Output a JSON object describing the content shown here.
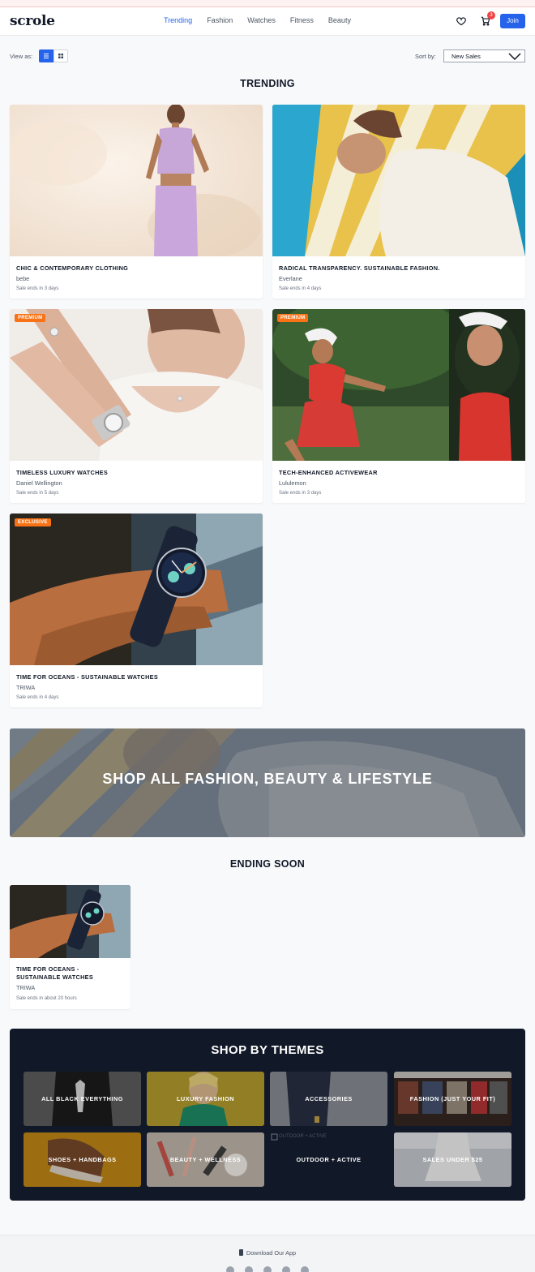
{
  "header": {
    "logo": "scrole",
    "nav": [
      "Trending",
      "Fashion",
      "Watches",
      "Fitness",
      "Beauty"
    ],
    "active_nav": "Trending",
    "cart_count": "3",
    "join_label": "Join"
  },
  "toolbar": {
    "view_as_label": "View as:",
    "sort_label": "Sort by:",
    "sort_value": "New Sales"
  },
  "trending": {
    "title": "TRENDING",
    "cards": [
      {
        "title": "CHIC & CONTEMPORARY CLOTHING",
        "brand": "bebe",
        "ends": "Sale ends in 3 days",
        "tag": ""
      },
      {
        "title": "RADICAL TRANSPARENCY. SUSTAINABLE FASHION.",
        "brand": "Everlane",
        "ends": "Sale ends in 4 days",
        "tag": ""
      },
      {
        "title": "TIMELESS LUXURY WATCHES",
        "brand": "Daniel Wellington",
        "ends": "Sale ends in 5 days",
        "tag": "PREMIUM"
      },
      {
        "title": "TECH-ENHANCED ACTIVEWEAR",
        "brand": "Lululemon",
        "ends": "Sale ends in 3 days",
        "tag": "PREMIUM"
      },
      {
        "title": "TIME FOR OCEANS - SUSTAINABLE WATCHES",
        "brand": "TRIWA",
        "ends": "Sale ends in 4 days",
        "tag": "EXCLUSIVE"
      }
    ]
  },
  "banner": {
    "text": "SHOP ALL FASHION, BEAUTY & LIFESTYLE"
  },
  "ending_soon": {
    "title": "ENDING SOON",
    "card": {
      "title_line1": "TIME FOR OCEANS -",
      "title_line2": "SUSTAINABLE WATCHES",
      "brand": "TRIWA",
      "ends": "Sale ends in about 20 hours"
    }
  },
  "themes": {
    "title": "SHOP BY THEMES",
    "tiles": [
      "ALL BLACK EVERYTHING",
      "LUXURY FASHION",
      "ACCESSORIES",
      "FASHION (JUST YOUR FIT)",
      "SHOES + HANDBAGS",
      "BEAUTY + WELLNESS",
      "OUTDOOR + ACTIVE",
      "SALES UNDER $25"
    ],
    "broken_image_alt": "OUTDOOR + ACTIVE"
  },
  "footer": {
    "download": "Download Our App",
    "socials": [
      "twitter-icon",
      "facebook-icon",
      "instagram-icon",
      "pinterest-icon",
      "tiktok-icon"
    ]
  },
  "colors": {
    "accent": "#2563eb",
    "tag": "#f97316",
    "themes_bg": "#111827",
    "badge": "#ef4444"
  }
}
